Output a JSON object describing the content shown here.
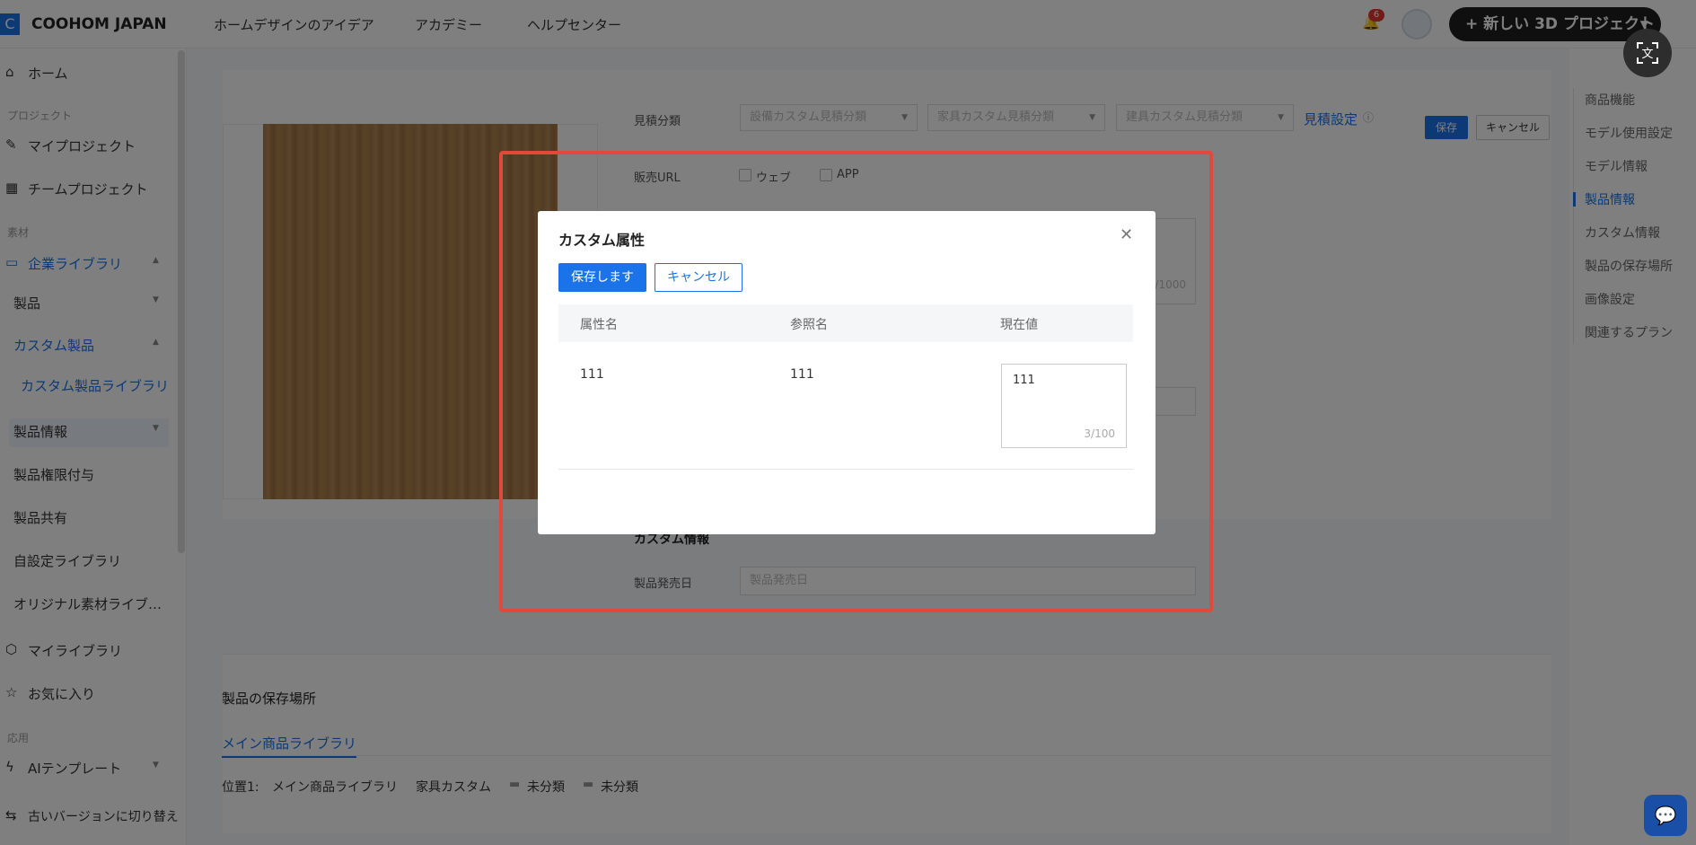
{
  "topbar": {
    "logo_letter": "C",
    "brand": "COOHOM JAPAN",
    "nav": [
      "ホームデザインのアイデア",
      "アカデミー",
      "ヘルプセンター"
    ],
    "notification_count": "6",
    "new_project": "+ 新しい 3D プロジェクト"
  },
  "sidebar": {
    "home": "ホーム",
    "group_project": "プロジェクト",
    "my_project": "マイプロジェクト",
    "team_project": "チームプロジェクト",
    "group_material": "素材",
    "enterprise_library": "企業ライブラリ",
    "product": "製品",
    "custom_product": "カスタム製品",
    "custom_product_library": "カスタム製品ライブラリ",
    "product_info": "製品情報",
    "product_permission": "製品権限付与",
    "product_share": "製品共有",
    "self_library": "自設定ライブラリ",
    "original_material": "オリジナル素材ライブ…",
    "my_library": "マイライブラリ",
    "favorites": "お気に入り",
    "group_app": "応用",
    "ai_template": "AIテンプレート",
    "old_version": "古いバージョンに切り替え"
  },
  "form": {
    "estimate_label": "見積分類",
    "select1": "設備カスタム見積分類",
    "select2": "家具カスタム見積分類",
    "select3": "建具カスタム見積分類",
    "estimate_settings": "見積設定",
    "save": "保存",
    "cancel": "キャンセル",
    "sales_url_label": "販売URL",
    "web": "ウェブ",
    "app": "APP",
    "counter_hint": "/1000",
    "custom_info_heading": "カスタム情報",
    "release_date_label": "製品発売日",
    "release_date_placeholder": "製品発売日"
  },
  "storage": {
    "heading": "製品の保存場所",
    "tab": "メイン商品ライブラリ",
    "path_label": "位置1:",
    "path": [
      "メイン商品ライブラリ",
      "家具カスタム",
      "未分類",
      "未分類"
    ]
  },
  "anchor_nav": [
    "商品機能",
    "モデル使用設定",
    "モデル情報",
    "製品情報",
    "カスタム情報",
    "製品の保存場所",
    "画像設定",
    "関連するプラン"
  ],
  "modal": {
    "title": "カスタム属性",
    "save": "保存します",
    "cancel": "キャンセル",
    "columns": [
      "属性名",
      "参照名",
      "現在値"
    ],
    "row": {
      "attr_name": "111",
      "ref_name": "111",
      "value": "111",
      "counter": "3/100"
    }
  },
  "icons": {
    "close": "close-icon",
    "translate": "translate-icon",
    "bell": "bell-icon",
    "chat": "chat-icon"
  },
  "colors": {
    "accent": "#1a73e8",
    "highlight_frame": "#e2493a"
  }
}
